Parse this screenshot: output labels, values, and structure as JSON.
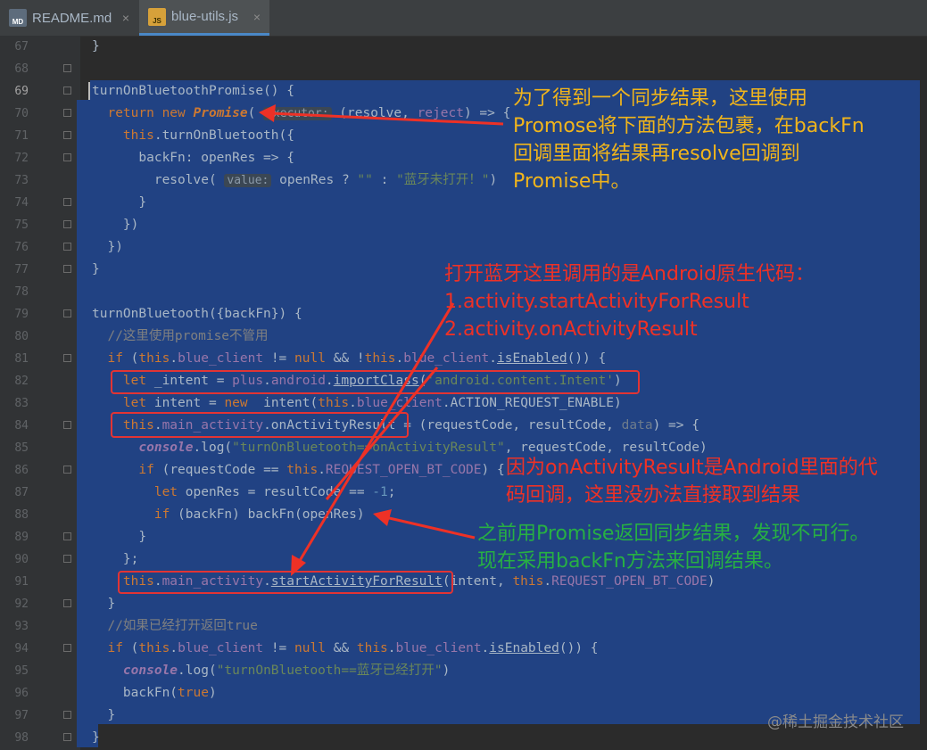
{
  "tabs": [
    {
      "label": "README.md",
      "icon": "MD",
      "close": "×"
    },
    {
      "label": "blue-utils.js",
      "icon": "JS",
      "close": "×"
    }
  ],
  "line_numbers": [
    "67",
    "68",
    "69",
    "70",
    "71",
    "72",
    "73",
    "74",
    "75",
    "76",
    "77",
    "78",
    "79",
    "80",
    "81",
    "82",
    "83",
    "84",
    "85",
    "86",
    "87",
    "88",
    "89",
    "90",
    "91",
    "92",
    "93",
    "94",
    "95",
    "96",
    "97",
    "98"
  ],
  "hints": {
    "executor": "executor:",
    "value": "value:"
  },
  "annotations": {
    "yellow": [
      "为了得到一个同步结果，这里使用",
      "Promose将下面的方法包裹，在backFn",
      "回调里面将结果再resolve回调到",
      "Promise中。"
    ],
    "red1": [
      "打开蓝牙这里调用的是Android原生代码：",
      "1.activity.startActivityForResult",
      "2.activity.onActivityResult"
    ],
    "red2": [
      "因为onActivityResult是Android里面的代",
      "码回调，这里没办法直接取到结果"
    ],
    "green": [
      "之前用Promise返回同步结果，发现不可行。",
      "现在采用backFn方法来回调结果。"
    ]
  },
  "watermark": "@稀土掘金技术社区",
  "colors": {
    "editor_bg": "#2b2b2b",
    "selection": "#214283",
    "annotation_yellow": "#f1b51b",
    "annotation_red": "#ee3126",
    "annotation_green": "#27b043",
    "keyword": "#cc7832",
    "string": "#6a8759",
    "field": "#9876aa"
  },
  "icons": [
    "md-file-icon",
    "js-file-icon",
    "close-icon",
    "fold-icon"
  ]
}
